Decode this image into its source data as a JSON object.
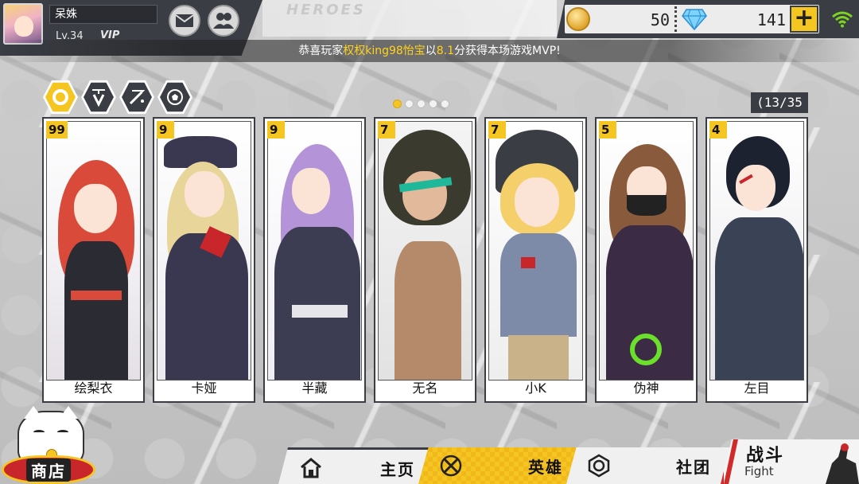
{
  "player": {
    "name": "呆姝",
    "level": "Lv.34",
    "vip": "VIP",
    "avatar": "player-avatar"
  },
  "header": {
    "mail_icon": "mail-icon",
    "friends_icon": "friends-icon",
    "ghost_text": "HEROES"
  },
  "resources": {
    "coins": "50",
    "gems": "141",
    "add_label": "+",
    "coin_icon": "gold-coin-icon",
    "gem_icon": "diamond-icon",
    "wifi_icon": "wifi-icon"
  },
  "announcement": {
    "prefix": "恭喜玩家",
    "player": "权权king98怡宝",
    "mid": "以",
    "score": "8.1",
    "suffix": "分获得本场游戏MVP!"
  },
  "filters": [
    {
      "name": "all",
      "icon": "ring-icon",
      "active": true
    },
    {
      "name": "tank",
      "icon": "shield-v-icon",
      "active": false
    },
    {
      "name": "mage",
      "icon": "wand-icon",
      "active": false
    },
    {
      "name": "support",
      "icon": "ball-icon",
      "active": false
    }
  ],
  "pager": {
    "total": 5,
    "current": 1
  },
  "hero_count": "(13/35",
  "heroes": [
    {
      "name": "绘梨衣",
      "level": "99",
      "colors": [
        "#d94a3a",
        "#2b2b33",
        "#ffffff"
      ]
    },
    {
      "name": "卡娅",
      "level": "9",
      "colors": [
        "#e8d59a",
        "#3a3850",
        "#f2f2f2"
      ]
    },
    {
      "name": "半藏",
      "level": "9",
      "colors": [
        "#b493d8",
        "#3c3d52",
        "#f3f3f3"
      ]
    },
    {
      "name": "无名",
      "level": "7",
      "colors": [
        "#3a3a2e",
        "#b58a6a",
        "#ececec"
      ]
    },
    {
      "name": "小K",
      "level": "7",
      "colors": [
        "#f5d06a",
        "#7d8ba8",
        "#f4f4f4"
      ]
    },
    {
      "name": "伪神",
      "level": "5",
      "colors": [
        "#8a5a3c",
        "#3c2b44",
        "#f2f2f2"
      ]
    },
    {
      "name": "左目",
      "level": "4",
      "colors": [
        "#1c2230",
        "#3a4356",
        "#f2f2f2"
      ]
    }
  ],
  "nav": {
    "shop": "商店",
    "home": "主页",
    "heroes": "英雄",
    "club": "社团",
    "fight_title": "战斗",
    "fight_sub": "Fight",
    "home_icon": "home-icon",
    "hero_icon": "crossed-swords-icon",
    "club_icon": "club-emblem-icon"
  },
  "colors": {
    "accent": "#f5c521",
    "dark": "#3a3d44",
    "highlight_text": "#ffd21e",
    "fight_red": "#d12a2a"
  }
}
